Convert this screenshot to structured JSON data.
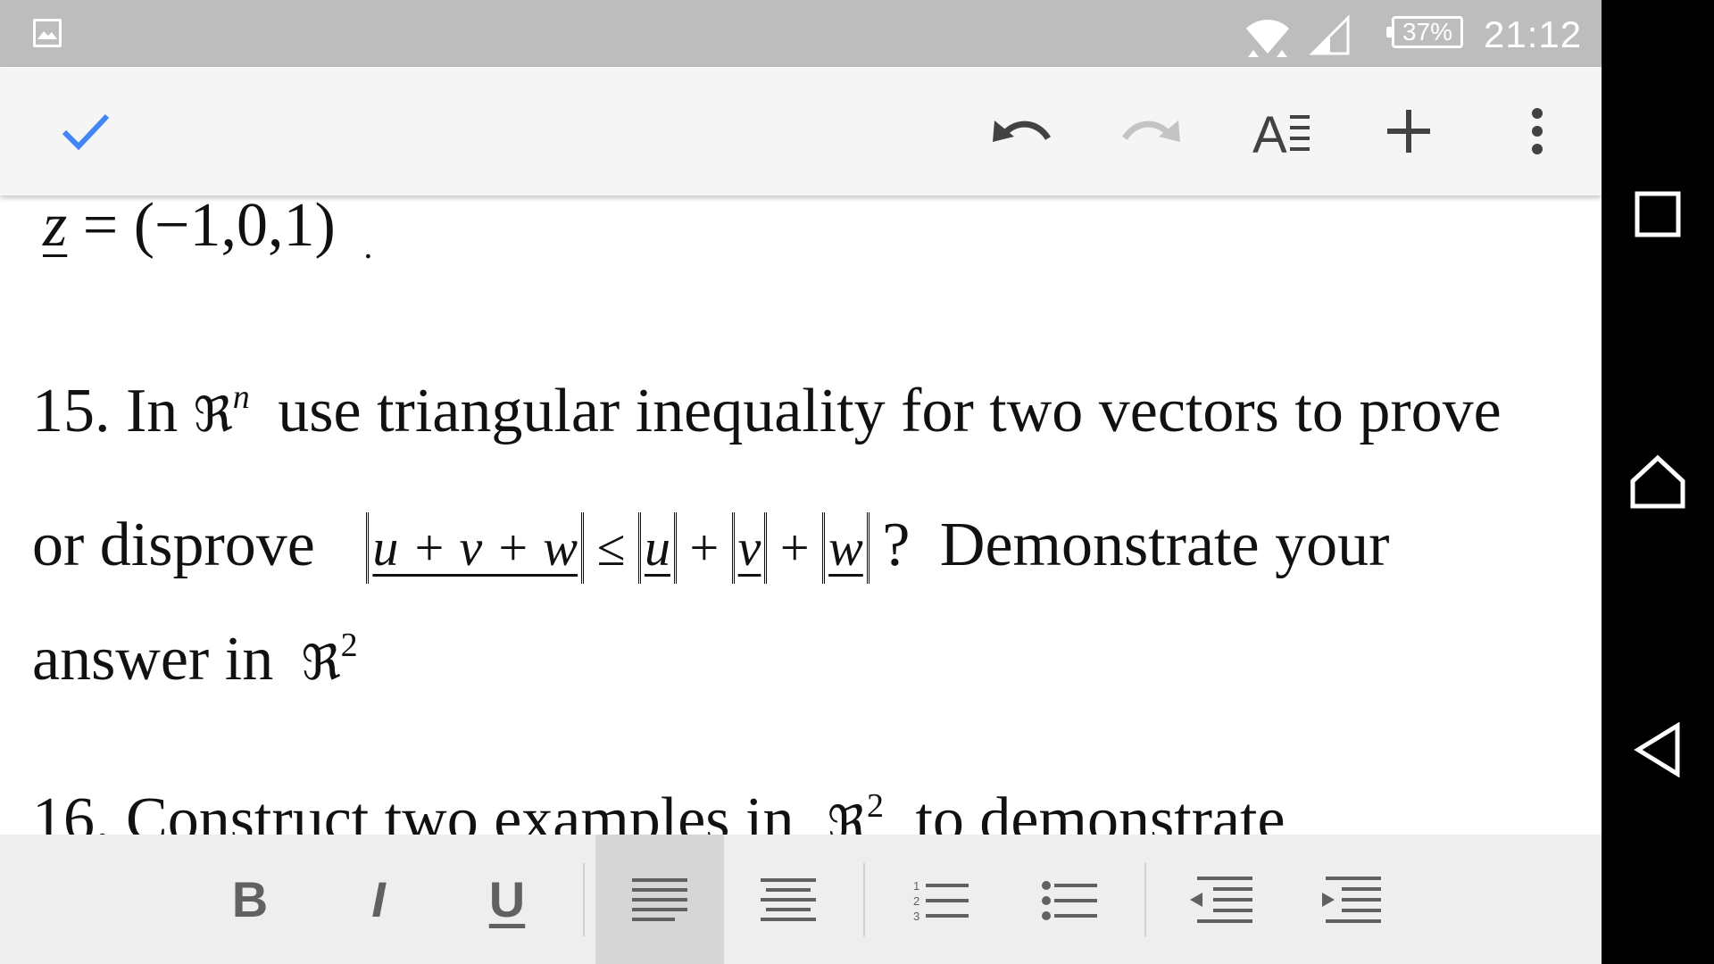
{
  "status_bar": {
    "battery": "37%",
    "time": "21:12",
    "icons": [
      "gallery-icon",
      "wifi-icon",
      "cell-signal-icon",
      "battery-icon"
    ]
  },
  "toolbar": {
    "buttons": [
      "done-check-icon",
      "undo-icon",
      "redo-icon",
      "text-format-icon",
      "insert-plus-icon",
      "more-vert-icon"
    ]
  },
  "document": {
    "z_line": {
      "lhs": "z",
      "rhs": " = (−1,0,1)",
      "trail": "."
    },
    "q15": {
      "number": "15. In",
      "space": "ℜ",
      "space_sup": "n",
      "text1": "use triangular inequality for two vectors to prove",
      "text2": "or disprove",
      "norm_lhs": "u + v + w",
      "leq": "≤",
      "norm_u": "u",
      "norm_v": "v",
      "norm_w": "w",
      "plus": "+",
      "after_norm": "?",
      "text3": "Demonstrate your",
      "text4": "answer in",
      "space2": "ℜ",
      "space2_sup": "2"
    },
    "q16": {
      "number": "16. Construct two examples in",
      "space": "ℜ",
      "space_sup": "2",
      "text": "to demonstrate"
    }
  },
  "format_bar": {
    "bold": "B",
    "italic": "I",
    "underline": "U",
    "buttons": [
      "align-left-icon",
      "align-center-icon",
      "numbered-list-icon",
      "bulleted-list-icon",
      "decrease-indent-icon",
      "increase-indent-icon"
    ],
    "active": "align-left",
    "active_color": "#d6d6d6"
  },
  "nav_bar": {
    "buttons": [
      "recents-square-icon",
      "home-icon",
      "back-icon"
    ]
  }
}
